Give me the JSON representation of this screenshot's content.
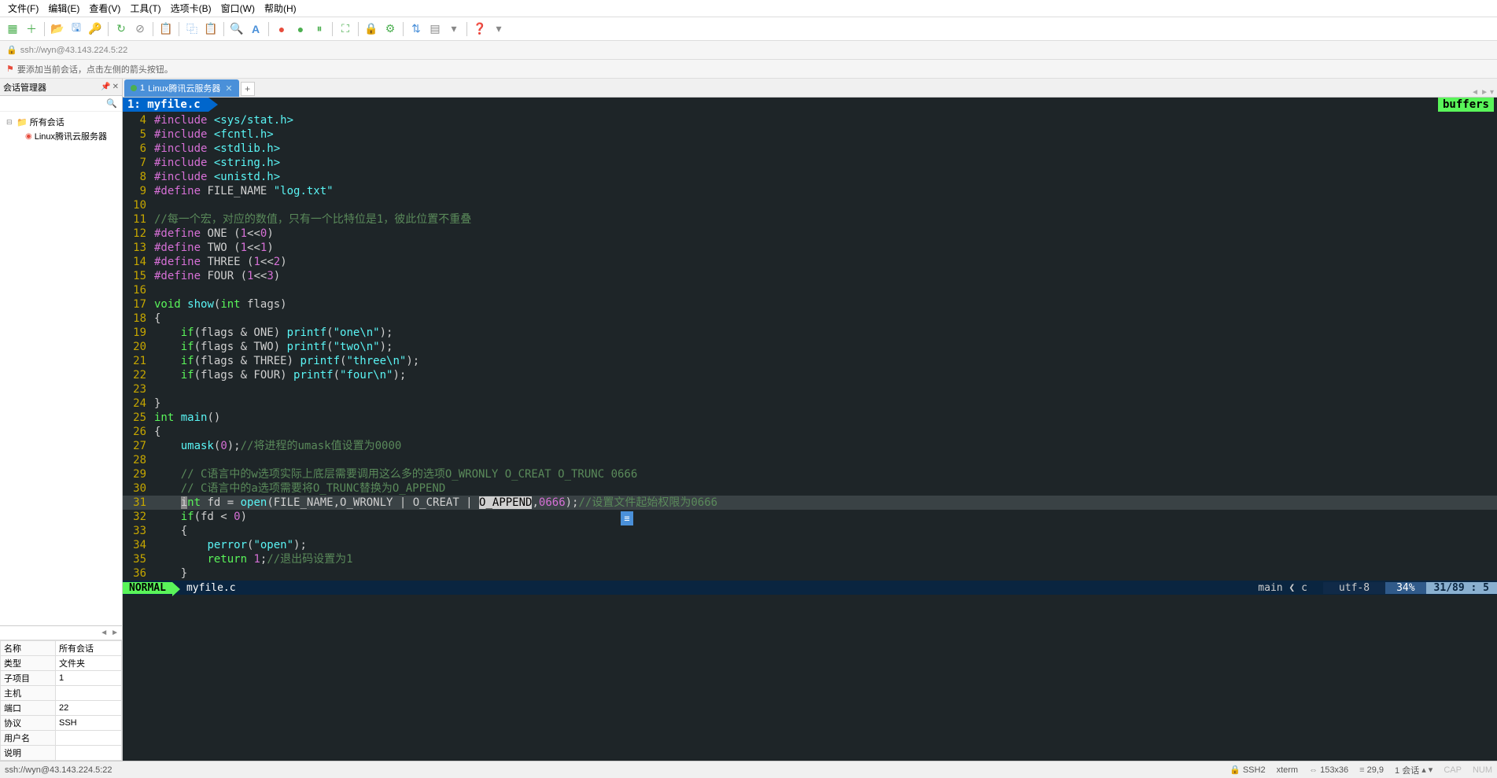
{
  "menu": [
    "文件(F)",
    "编辑(E)",
    "查看(V)",
    "工具(T)",
    "选项卡(B)",
    "窗口(W)",
    "帮助(H)"
  ],
  "address": "ssh://wyn@43.143.224.5:22",
  "infobar": "要添加当前会话，点击左侧的箭头按钮。",
  "sidebar": {
    "title": "会话管理器",
    "root": "所有会话",
    "child": "Linux腾讯云服务器"
  },
  "props": {
    "rows": [
      [
        "名称",
        "所有会话"
      ],
      [
        "类型",
        "文件夹"
      ],
      [
        "子项目",
        "1"
      ],
      [
        "主机",
        ""
      ],
      [
        "端口",
        "22"
      ],
      [
        "协议",
        "SSH"
      ],
      [
        "用户名",
        ""
      ],
      [
        "说明",
        ""
      ]
    ]
  },
  "tab": {
    "num": "1",
    "label": "Linux腾讯云服务器"
  },
  "vim": {
    "bufferTab": "1: myfile.c",
    "buffersLabel": "buffers",
    "status": {
      "mode": "NORMAL",
      "file": "myfile.c",
      "git": "main ❮ c",
      "enc": "utf-8",
      "pct": "34%",
      "pos": "31/89 :  5"
    },
    "code": [
      {
        "n": 4,
        "seg": [
          [
            "c-pp",
            "#include "
          ],
          [
            "c-inc",
            "<sys/stat.h>"
          ]
        ]
      },
      {
        "n": 5,
        "seg": [
          [
            "c-pp",
            "#include "
          ],
          [
            "c-inc",
            "<fcntl.h>"
          ]
        ]
      },
      {
        "n": 6,
        "seg": [
          [
            "c-pp",
            "#include "
          ],
          [
            "c-inc",
            "<stdlib.h>"
          ]
        ]
      },
      {
        "n": 7,
        "seg": [
          [
            "c-pp",
            "#include "
          ],
          [
            "c-inc",
            "<string.h>"
          ]
        ]
      },
      {
        "n": 8,
        "seg": [
          [
            "c-pp",
            "#include "
          ],
          [
            "c-inc",
            "<unistd.h>"
          ]
        ]
      },
      {
        "n": 9,
        "seg": [
          [
            "c-pp",
            "#define "
          ],
          [
            "",
            "FILE_NAME "
          ],
          [
            "c-str",
            "\"log.txt\""
          ]
        ]
      },
      {
        "n": 10,
        "seg": []
      },
      {
        "n": 11,
        "seg": [
          [
            "c-cmt",
            "//每一个宏，对应的数值，只有一个比特位是1，彼此位置不重叠"
          ]
        ]
      },
      {
        "n": 12,
        "seg": [
          [
            "c-pp",
            "#define "
          ],
          [
            "",
            "ONE ("
          ],
          [
            "c-num",
            "1"
          ],
          [
            "",
            "<<"
          ],
          [
            "c-num",
            "0"
          ],
          [
            "",
            ")"
          ]
        ]
      },
      {
        "n": 13,
        "seg": [
          [
            "c-pp",
            "#define "
          ],
          [
            "",
            "TWO ("
          ],
          [
            "c-num",
            "1"
          ],
          [
            "",
            "<<"
          ],
          [
            "c-num",
            "1"
          ],
          [
            "",
            ")"
          ]
        ]
      },
      {
        "n": 14,
        "seg": [
          [
            "c-pp",
            "#define "
          ],
          [
            "",
            "THREE ("
          ],
          [
            "c-num",
            "1"
          ],
          [
            "",
            "<<"
          ],
          [
            "c-num",
            "2"
          ],
          [
            "",
            ")"
          ]
        ]
      },
      {
        "n": 15,
        "seg": [
          [
            "c-pp",
            "#define "
          ],
          [
            "",
            "FOUR ("
          ],
          [
            "c-num",
            "1"
          ],
          [
            "",
            "<<"
          ],
          [
            "c-num",
            "3"
          ],
          [
            "",
            ")"
          ]
        ]
      },
      {
        "n": 16,
        "seg": []
      },
      {
        "n": 17,
        "seg": [
          [
            "c-type",
            "void "
          ],
          [
            "c-fn",
            "show"
          ],
          [
            "",
            "("
          ],
          [
            "c-type",
            "int"
          ],
          [
            "",
            " flags)"
          ]
        ]
      },
      {
        "n": 18,
        "seg": [
          [
            "",
            "{"
          ]
        ]
      },
      {
        "n": 19,
        "seg": [
          [
            "",
            "    "
          ],
          [
            "c-kw",
            "if"
          ],
          [
            "",
            "(flags & ONE) "
          ],
          [
            "c-fn",
            "printf"
          ],
          [
            "",
            "("
          ],
          [
            "c-str",
            "\"one\\n\""
          ],
          [
            "",
            ");"
          ]
        ]
      },
      {
        "n": 20,
        "seg": [
          [
            "",
            "    "
          ],
          [
            "c-kw",
            "if"
          ],
          [
            "",
            "(flags & TWO) "
          ],
          [
            "c-fn",
            "printf"
          ],
          [
            "",
            "("
          ],
          [
            "c-str",
            "\"two\\n\""
          ],
          [
            "",
            ");"
          ]
        ]
      },
      {
        "n": 21,
        "seg": [
          [
            "",
            "    "
          ],
          [
            "c-kw",
            "if"
          ],
          [
            "",
            "(flags & THREE) "
          ],
          [
            "c-fn",
            "printf"
          ],
          [
            "",
            "("
          ],
          [
            "c-str",
            "\"three\\n\""
          ],
          [
            "",
            ");"
          ]
        ]
      },
      {
        "n": 22,
        "seg": [
          [
            "",
            "    "
          ],
          [
            "c-kw",
            "if"
          ],
          [
            "",
            "(flags & FOUR) "
          ],
          [
            "c-fn",
            "printf"
          ],
          [
            "",
            "("
          ],
          [
            "c-str",
            "\"four\\n\""
          ],
          [
            "",
            ");"
          ]
        ]
      },
      {
        "n": 23,
        "seg": []
      },
      {
        "n": 24,
        "seg": [
          [
            "",
            "}"
          ]
        ]
      },
      {
        "n": 25,
        "seg": [
          [
            "c-type",
            "int "
          ],
          [
            "c-fn",
            "main"
          ],
          [
            "",
            "()"
          ]
        ]
      },
      {
        "n": 26,
        "seg": [
          [
            "",
            "{"
          ]
        ]
      },
      {
        "n": 27,
        "seg": [
          [
            "",
            "    "
          ],
          [
            "c-fn",
            "umask"
          ],
          [
            "",
            "("
          ],
          [
            "c-num",
            "0"
          ],
          [
            "",
            ");"
          ],
          [
            "c-cmt",
            "//将进程的umask值设置为0000"
          ]
        ]
      },
      {
        "n": 28,
        "seg": []
      },
      {
        "n": 29,
        "seg": [
          [
            "",
            "    "
          ],
          [
            "c-cmt",
            "// C语言中的w选项实际上底层需要调用这么多的选项O_WRONLY O_CREAT O_TRUNC 0666"
          ]
        ]
      },
      {
        "n": 30,
        "seg": [
          [
            "",
            "    "
          ],
          [
            "c-cmt",
            "// C语言中的a选项需要将O_TRUNC替换为O_APPEND"
          ]
        ]
      },
      {
        "n": 31,
        "cur": true,
        "seg": [
          [
            "",
            "    "
          ],
          [
            "c-cursor",
            "i"
          ],
          [
            "c-type",
            "nt"
          ],
          [
            "",
            " fd = "
          ],
          [
            "c-fn",
            "open"
          ],
          [
            "",
            "(FILE_NAME,O_WRONLY | O_CREAT | "
          ],
          [
            "c-hl",
            "O_APPEND"
          ],
          [
            "",
            ","
          ],
          [
            "c-num",
            "0666"
          ],
          [
            "",
            ");"
          ],
          [
            "c-cmt",
            "//设置文件起始权限为0666"
          ]
        ]
      },
      {
        "n": 32,
        "seg": [
          [
            "",
            "    "
          ],
          [
            "c-kw",
            "if"
          ],
          [
            "",
            "(fd < "
          ],
          [
            "c-num",
            "0"
          ],
          [
            "",
            ")"
          ]
        ]
      },
      {
        "n": 33,
        "seg": [
          [
            "",
            "    {"
          ]
        ]
      },
      {
        "n": 34,
        "seg": [
          [
            "",
            "        "
          ],
          [
            "c-fn",
            "perror"
          ],
          [
            "",
            "("
          ],
          [
            "c-str",
            "\"open\""
          ],
          [
            "",
            ");"
          ]
        ]
      },
      {
        "n": 35,
        "seg": [
          [
            "",
            "        "
          ],
          [
            "c-kw",
            "return"
          ],
          [
            "",
            " "
          ],
          [
            "c-num",
            "1"
          ],
          [
            "",
            ";"
          ],
          [
            "c-cmt",
            "//退出码设置为1"
          ]
        ]
      },
      {
        "n": 36,
        "seg": [
          [
            "",
            "    }"
          ]
        ]
      }
    ]
  },
  "statusbar": {
    "left": "ssh://wyn@43.143.224.5:22",
    "ssh": "SSH2",
    "term": "xterm",
    "size": "153x36",
    "pos": "29,9",
    "session": "1 会话",
    "cap": "CAP",
    "num": "NUM"
  }
}
